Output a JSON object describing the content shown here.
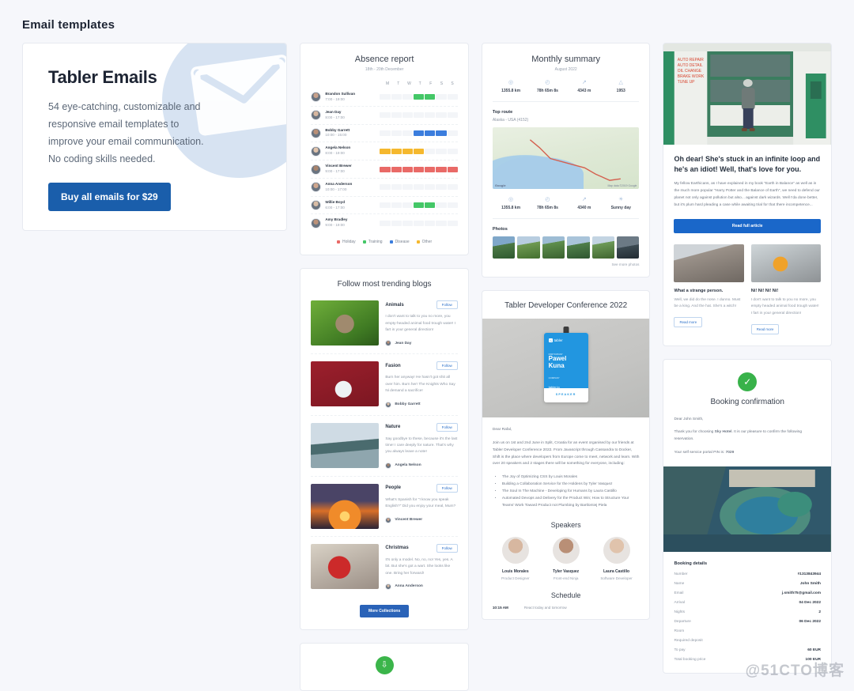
{
  "page": {
    "title": "Email templates"
  },
  "hero": {
    "title": "Tabler Emails",
    "description": "54 eye-catching, customizable and responsive email templates to improve your email communication. No coding skills needed.",
    "cta": "Buy all emails for $29",
    "accent": "#1a5eab",
    "circle_color": "#d7e3f2"
  },
  "absence": {
    "title": "Absence report",
    "subtitle": "18th - 20th December",
    "day_headers": [
      "M",
      "T",
      "W",
      "T",
      "F",
      "S",
      "S"
    ],
    "rows": [
      {
        "name": "Brandon Sullivan",
        "time": "7:00 - 19:00",
        "color": "#44c767",
        "start": 3,
        "span": 2
      },
      {
        "name": "Jean Day",
        "time": "8:00 - 17:00",
        "color": "#44c767",
        "start": 0,
        "span": 0
      },
      {
        "name": "Bobby Garrett",
        "time": "10:00 - 15:00",
        "color": "#3b7ddd",
        "start": 3,
        "span": 3
      },
      {
        "name": "Angela Nelson",
        "time": "8:00 - 19:00",
        "color": "#f5b82e",
        "start": 0,
        "span": 4
      },
      {
        "name": "Vincent Brewer",
        "time": "9:00 - 17:00",
        "color": "#e96a67",
        "start": 0,
        "span": 7
      },
      {
        "name": "Anna Anderson",
        "time": "10:00 - 17:00",
        "color": "#44c767",
        "start": 0,
        "span": 0
      },
      {
        "name": "Willie Boyd",
        "time": "6:00 - 17:00",
        "color": "#44c767",
        "start": 3,
        "span": 2
      },
      {
        "name": "Amy Bradley",
        "time": "9:00 - 19:00",
        "color": "#44c767",
        "start": 0,
        "span": 0
      }
    ],
    "legend": [
      {
        "label": "Holiday",
        "color": "#e96a67"
      },
      {
        "label": "Training",
        "color": "#44c767"
      },
      {
        "label": "Disease",
        "color": "#3b7ddd"
      },
      {
        "label": "Other",
        "color": "#f5b82e"
      }
    ]
  },
  "summary": {
    "title": "Monthly summary",
    "subtitle": "August 2022",
    "stats_top": [
      {
        "icon": "target-icon",
        "glyph": "◎",
        "value": "1355.8 km"
      },
      {
        "icon": "clock-icon",
        "glyph": "◴",
        "value": "78h 65m 8s"
      },
      {
        "icon": "elevation-icon",
        "glyph": "↗",
        "value": "4343 m"
      },
      {
        "icon": "thumb-up-icon",
        "glyph": "△",
        "value": "1953"
      }
    ],
    "route_label": "Top route",
    "route_value": "Alaska - USA (4152)",
    "map_brand": "Google",
    "map_credit": "Map data ©2019 Google",
    "stats_bottom": [
      {
        "icon": "target-icon",
        "glyph": "◎",
        "value": "1355.8 km"
      },
      {
        "icon": "clock-icon",
        "glyph": "◴",
        "value": "78h 65m 8s"
      },
      {
        "icon": "elevation-icon",
        "glyph": "↗",
        "value": "4340 m"
      },
      {
        "icon": "sun-icon",
        "glyph": "☀",
        "value": "Sunny day"
      }
    ],
    "photos_label": "Photos",
    "photos_link": "See more photos",
    "photo_count": 6
  },
  "blogs": {
    "title": "Follow most trending blogs",
    "follow_label": "Follow",
    "more_label": "More Collections",
    "items": [
      {
        "category": "Animals",
        "text": "I don't want to talk to you no more, you empty-headed animal food trough water! I fart in your general direction!",
        "author": "Jean Day",
        "img": "monkey-photo"
      },
      {
        "category": "Fasion",
        "text": "Burn her anyway! He hasn't got shit all over him. Burn her! The Knights Who Say Ni demand a sacrifice!",
        "author": "Bobby Garrett",
        "img": "fashion-photo"
      },
      {
        "category": "Nature",
        "text": "Say goodbye to these, because it's the last time! I care deeply for nature. That's why you always leave a note!",
        "author": "Angela Nelson",
        "img": "nature-photo"
      },
      {
        "category": "People",
        "text": "What's Spanish for \"I know you speak English?\" Did you enjoy your meal, Mum?",
        "author": "Vincent Brewer",
        "img": "sunset-photo"
      },
      {
        "category": "Christmas",
        "text": "It's only a model. No, no, no! Yes, yes. A bit. But she's got a wart. She looks like one. Bring her forward!",
        "author": "Anna Anderson",
        "img": "santa-photo"
      }
    ]
  },
  "download_card": {
    "icon": "download-icon",
    "color": "#3bb54a"
  },
  "conference": {
    "title": "Tabler Developer Conference 2022",
    "badge": {
      "brand": "tabler",
      "kicker": "PARTICIPANT",
      "name_line1": "Pawel",
      "name_line2": "Kuna",
      "url_kicker": "COMPANY",
      "url": "tabler.io",
      "footer": "SPEAKER"
    },
    "greeting": "Dear Rafal,",
    "body": "Join us on 1st and 2nd June in Split, Croatia for an event organised by our friends at Tabler Developer Conference 2022. From Javascript through Cassandra to Docker, Shift is the place where developers from Europe come to meet, network and learn. With over 20 speakers and 2 stages there will be something for everyone, including:",
    "bullets": [
      "The Joy of Optimizing CSS by Louis Morales",
      "Building a Collaboration Service for the Holdens by Tyler Vasquez",
      "The Soul In The Machine - Developing for Humans by Laura Castillo",
      "Automated Devops and Delivery for the Product Win; How to Structure Your Teams' Work Toward Product not Plumbing by Bartlomiej Piela"
    ],
    "speakers_title": "Speakers",
    "speakers": [
      {
        "name": "Louis Morales",
        "role": "Product Designer"
      },
      {
        "name": "Tyler Vasquez",
        "role": "Front-end Ninja"
      },
      {
        "name": "Laura Castillo",
        "role": "Software Developer"
      }
    ],
    "schedule_title": "Schedule",
    "schedule": [
      {
        "time": "10:15 AM",
        "desc": "React today and tomorrow"
      }
    ]
  },
  "article": {
    "headline": "Oh dear! She's stuck in an infinite loop and he's an idiot! Well, that's love for you.",
    "body": "My fellow Earthicans, as I have explained in my book \"Earth in Balance\" as well as in the much more popular \"Harry Potter and the Balance of Earth\", we need to defend our planet not only against pollution but also... against dark wizards. Well I'da done better, but it's plum hard pleading a case while awaiting trial for that there incompetence...",
    "cta": "Read full article",
    "sub_articles": [
      {
        "title": "What a strange person.",
        "text": "Well, we did do the nose. I dunno. Must be a king. And the hat. She's a witch!",
        "cta": "Read more"
      },
      {
        "title": "Ni! Ni! Ni! Ni!",
        "text": "I don't want to talk to you no more, you empty headed animal food trough water! I fart in your general direction!",
        "cta": "Read more"
      }
    ]
  },
  "booking": {
    "icon": "check-circle-icon",
    "title": "Booking confirmation",
    "greeting": "Dear John Smith,",
    "body_prefix": "Thank you for choosing ",
    "hotel": "Sky Hotel",
    "body_suffix": ". It is our pleasure to confirm the following reservation.",
    "pin_label": "Your self service portal PIN is: ",
    "pin": "7029",
    "details_title": "Booking details",
    "details": [
      {
        "key": "Number",
        "value": "#1313843944"
      },
      {
        "key": "Name",
        "value": "John Smith"
      },
      {
        "key": "Email",
        "value": "j.smith75@gmail.com"
      },
      {
        "key": "Arrival",
        "value": "04 Dec 2022"
      },
      {
        "key": "Nights",
        "value": "2"
      },
      {
        "key": "Departure",
        "value": "06 Dec 2022"
      },
      {
        "key": "Room",
        "value": ""
      },
      {
        "key": "Required deposit",
        "value": ""
      },
      {
        "key": "To pay",
        "value": "60 EUR"
      },
      {
        "key": "Total booking price",
        "value": "100 EUR"
      }
    ]
  },
  "watermark": {
    "text": "@51CTO博客"
  }
}
